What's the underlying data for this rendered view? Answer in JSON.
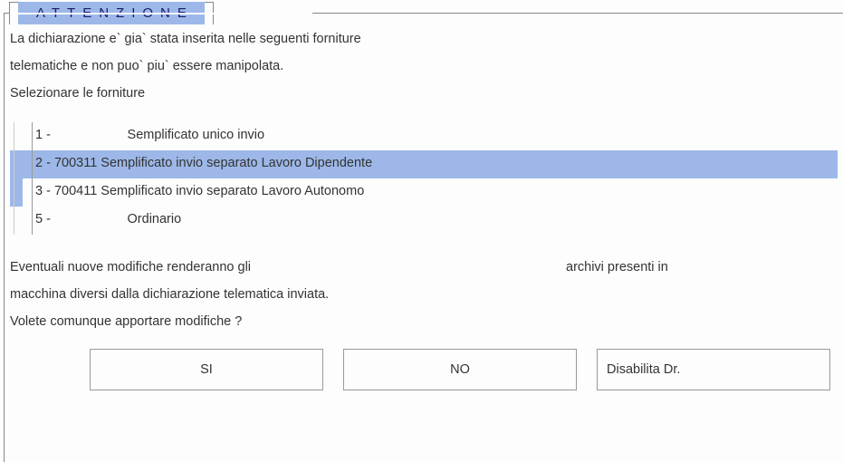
{
  "tab": {
    "title": "ATTENZIONE"
  },
  "message": {
    "line1": "La dichiarazione e` gia` stata inserita nelle seguenti forniture",
    "line2": "telematiche e non puo` piu` essere manipolata.",
    "line3": "Selezionare le forniture"
  },
  "list": {
    "items": [
      {
        "text": "1 -                     Semplificato unico invio",
        "selected": false
      },
      {
        "text": "2 - 700311 Semplificato invio separato Lavoro Dipendente",
        "selected": true
      },
      {
        "text": "3 - 700411 Semplificato invio separato Lavoro Autonomo",
        "selected": false
      },
      {
        "text": "5 -                     Ordinario",
        "selected": false
      }
    ]
  },
  "footer": {
    "line1_left": "Eventuali nuove modifiche renderanno gli",
    "line1_right": "archivi presenti in",
    "line2": "macchina diversi dalla dichiarazione telematica inviata.",
    "line3": "Volete comunque apportare modifiche ?"
  },
  "buttons": {
    "yes": "SI",
    "no": "NO",
    "disable": "Disabilita Dr."
  }
}
